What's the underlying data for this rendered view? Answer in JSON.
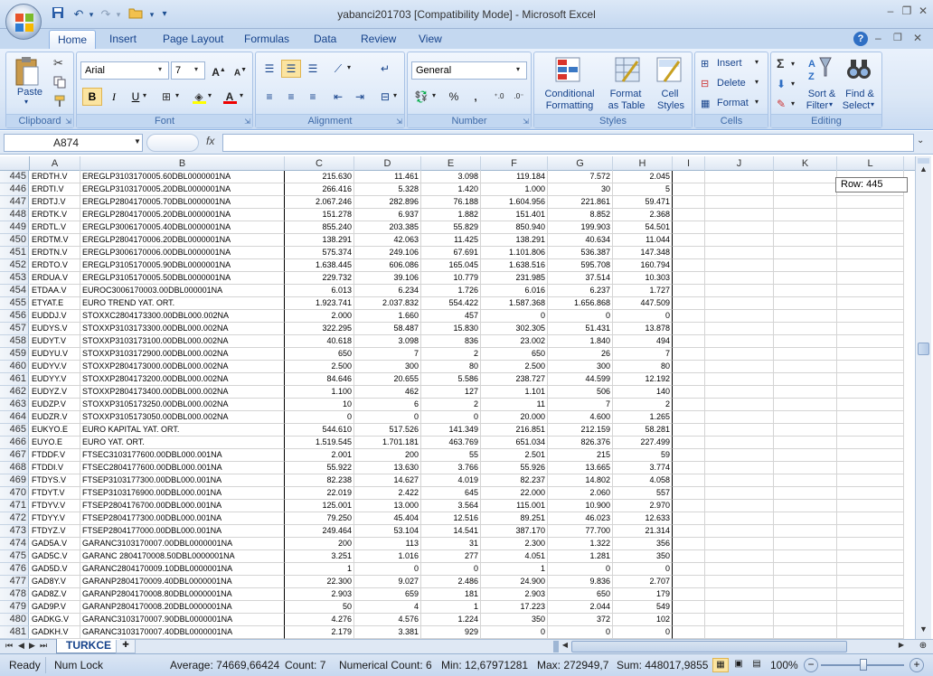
{
  "window": {
    "title": "yabanci201703  [Compatibility Mode] - Microsoft Excel"
  },
  "quick_access": [
    "save-icon",
    "undo-icon",
    "redo-icon",
    "open-icon"
  ],
  "tabs": [
    "Home",
    "Insert",
    "Page Layout",
    "Formulas",
    "Data",
    "Review",
    "View"
  ],
  "ribbon": {
    "clipboard": {
      "label": "Clipboard",
      "paste": "Paste"
    },
    "font": {
      "label": "Font",
      "name": "Arial",
      "size": "7"
    },
    "alignment": {
      "label": "Alignment"
    },
    "number": {
      "label": "Number",
      "format": "General",
      "percent": "%",
      "comma": ","
    },
    "styles": {
      "label": "Styles",
      "conditional": "Conditional",
      "conditional2": "Formatting",
      "format_table": "Format",
      "format_table2": "as Table",
      "cell_styles": "Cell",
      "cell_styles2": "Styles"
    },
    "cells": {
      "label": "Cells",
      "insert": "Insert",
      "delete": "Delete",
      "format": "Format"
    },
    "editing": {
      "label": "Editing",
      "sort": "Sort &",
      "sort2": "Filter",
      "find": "Find &",
      "find2": "Select"
    }
  },
  "formula_bar": {
    "name_box": "A874",
    "fx": "fx",
    "value": ""
  },
  "columns": [
    "A",
    "B",
    "C",
    "D",
    "E",
    "F",
    "G",
    "H",
    "I",
    "J",
    "K",
    "L"
  ],
  "rows": [
    [
      "445",
      "ERDTH.V",
      "EREGLP3103170005.60DBL0000001NA",
      "215.630",
      "11.461",
      "3.098",
      "119.184",
      "7.572",
      "2.045"
    ],
    [
      "446",
      "ERDTI.V",
      "EREGLP3103170005.20DBL0000001NA",
      "266.416",
      "5.328",
      "1.420",
      "1.000",
      "30",
      "5"
    ],
    [
      "447",
      "ERDTJ.V",
      "EREGLP2804170005.70DBL0000001NA",
      "2.067.246",
      "282.896",
      "76.188",
      "1.604.956",
      "221.861",
      "59.471"
    ],
    [
      "448",
      "ERDTK.V",
      "EREGLP2804170005.20DBL0000001NA",
      "151.278",
      "6.937",
      "1.882",
      "151.401",
      "8.852",
      "2.368"
    ],
    [
      "449",
      "ERDTL.V",
      "EREGLP3006170005.40DBL0000001NA",
      "855.240",
      "203.385",
      "55.829",
      "850.940",
      "199.903",
      "54.501"
    ],
    [
      "450",
      "ERDTM.V",
      "EREGLP2804170006.20DBL0000001NA",
      "138.291",
      "42.063",
      "11.425",
      "138.291",
      "40.634",
      "11.044"
    ],
    [
      "451",
      "ERDTN.V",
      "EREGLP3006170006.00DBL0000001NA",
      "575.374",
      "249.106",
      "67.691",
      "1.101.806",
      "536.387",
      "147.348"
    ],
    [
      "452",
      "ERDTO.V",
      "EREGLP3105170005.90DBL0000001NA",
      "1.638.445",
      "606.086",
      "165.045",
      "1.638.516",
      "595.708",
      "160.794"
    ],
    [
      "453",
      "ERDUA.V",
      "EREGLP3105170005.50DBL0000001NA",
      "229.732",
      "39.106",
      "10.779",
      "231.985",
      "37.514",
      "10.303"
    ],
    [
      "454",
      "ETDAA.V",
      "EUROC3006170003.00DBL000001NA",
      "6.013",
      "6.234",
      "1.726",
      "6.016",
      "6.237",
      "1.727"
    ],
    [
      "455",
      "ETYAT.E",
      "EURO TREND YAT. ORT.",
      "1.923.741",
      "2.037.832",
      "554.422",
      "1.587.368",
      "1.656.868",
      "447.509"
    ],
    [
      "456",
      "EUDDJ.V",
      "STOXXC2804173300.00DBL000.002NA",
      "2.000",
      "1.660",
      "457",
      "0",
      "0",
      "0"
    ],
    [
      "457",
      "EUDYS.V",
      "STOXXP3103173300.00DBL000.002NA",
      "322.295",
      "58.487",
      "15.830",
      "302.305",
      "51.431",
      "13.878"
    ],
    [
      "458",
      "EUDYT.V",
      "STOXXP3103173100.00DBL000.002NA",
      "40.618",
      "3.098",
      "836",
      "23.002",
      "1.840",
      "494"
    ],
    [
      "459",
      "EUDYU.V",
      "STOXXP3103172900.00DBL000.002NA",
      "650",
      "7",
      "2",
      "650",
      "26",
      "7"
    ],
    [
      "460",
      "EUDYV.V",
      "STOXXP2804173000.00DBL000.002NA",
      "2.500",
      "300",
      "80",
      "2.500",
      "300",
      "80"
    ],
    [
      "461",
      "EUDYY.V",
      "STOXXP2804173200.00DBL000.002NA",
      "84.646",
      "20.655",
      "5.586",
      "238.727",
      "44.599",
      "12.192"
    ],
    [
      "462",
      "EUDYZ.V",
      "STOXXP2804173400.00DBL000.002NA",
      "1.100",
      "462",
      "127",
      "1.101",
      "506",
      "140"
    ],
    [
      "463",
      "EUDZP.V",
      "STOXXP3105173250.00DBL000.002NA",
      "10",
      "6",
      "2",
      "11",
      "7",
      "2"
    ],
    [
      "464",
      "EUDZR.V",
      "STOXXP3105173050.00DBL000.002NA",
      "0",
      "0",
      "0",
      "20.000",
      "4.600",
      "1.265"
    ],
    [
      "465",
      "EUKYO.E",
      "EURO KAPITAL YAT. ORT.",
      "544.610",
      "517.526",
      "141.349",
      "216.851",
      "212.159",
      "58.281"
    ],
    [
      "466",
      "EUYO.E",
      "EURO YAT. ORT.",
      "1.519.545",
      "1.701.181",
      "463.769",
      "651.034",
      "826.376",
      "227.499"
    ],
    [
      "467",
      "FTDDF.V",
      "FTSEC3103177600.00DBL000.001NA",
      "2.001",
      "200",
      "55",
      "2.501",
      "215",
      "59"
    ],
    [
      "468",
      "FTDDI.V",
      "FTSEC2804177600.00DBL000.001NA",
      "55.922",
      "13.630",
      "3.766",
      "55.926",
      "13.665",
      "3.774"
    ],
    [
      "469",
      "FTDYS.V",
      "FTSEP3103177300.00DBL000.001NA",
      "82.238",
      "14.627",
      "4.019",
      "82.237",
      "14.802",
      "4.058"
    ],
    [
      "470",
      "FTDYT.V",
      "FTSEP3103176900.00DBL000.001NA",
      "22.019",
      "2.422",
      "645",
      "22.000",
      "2.060",
      "557"
    ],
    [
      "471",
      "FTDYV.V",
      "FTSEP2804176700.00DBL000.001NA",
      "125.001",
      "13.000",
      "3.564",
      "115.001",
      "10.900",
      "2.970"
    ],
    [
      "472",
      "FTDYY.V",
      "FTSEP2804177300.00DBL000.001NA",
      "79.250",
      "45.404",
      "12.516",
      "89.251",
      "46.023",
      "12.633"
    ],
    [
      "473",
      "FTDYZ.V",
      "FTSEP2804177000.00DBL000.001NA",
      "249.464",
      "53.104",
      "14.541",
      "387.170",
      "77.700",
      "21.314"
    ],
    [
      "474",
      "GAD5A.V",
      "GARANC3103170007.00DBL0000001NA",
      "200",
      "113",
      "31",
      "2.300",
      "1.322",
      "356"
    ],
    [
      "475",
      "GAD5C.V",
      "GARANC 2804170008.50DBL0000001NA",
      "3.251",
      "1.016",
      "277",
      "4.051",
      "1.281",
      "350"
    ],
    [
      "476",
      "GAD5D.V",
      "GARANC2804170009.10DBL0000001NA",
      "1",
      "0",
      "0",
      "1",
      "0",
      "0"
    ],
    [
      "477",
      "GAD8Y.V",
      "GARANP2804170009.40DBL0000001NA",
      "22.300",
      "9.027",
      "2.486",
      "24.900",
      "9.836",
      "2.707"
    ],
    [
      "478",
      "GAD8Z.V",
      "GARANP2804170008.80DBL0000001NA",
      "2.903",
      "659",
      "181",
      "2.903",
      "650",
      "179"
    ],
    [
      "479",
      "GAD9P.V",
      "GARANP2804170008.20DBL0000001NA",
      "50",
      "4",
      "1",
      "17.223",
      "2.044",
      "549"
    ],
    [
      "480",
      "GADKG.V",
      "GARANC3103170007.90DBL0000001NA",
      "4.276",
      "4.576",
      "1.224",
      "350",
      "372",
      "102"
    ],
    [
      "481",
      "GADKH.V",
      "GARANC3103170007.40DBL0000001NA",
      "2.179",
      "3.381",
      "929",
      "0",
      "0",
      "0"
    ]
  ],
  "tooltip": "Row: 445",
  "sheet_tab": "TURKCE",
  "status": {
    "ready": "Ready",
    "numlock": "Num Lock",
    "average": "Average: 74669,66424",
    "count": "Count: 7",
    "numcount": "Numerical Count: 6",
    "min": "Min: 12,67971281",
    "max": "Max: 272949,7",
    "sum": "Sum: 448017,9855",
    "zoom": "100%"
  }
}
